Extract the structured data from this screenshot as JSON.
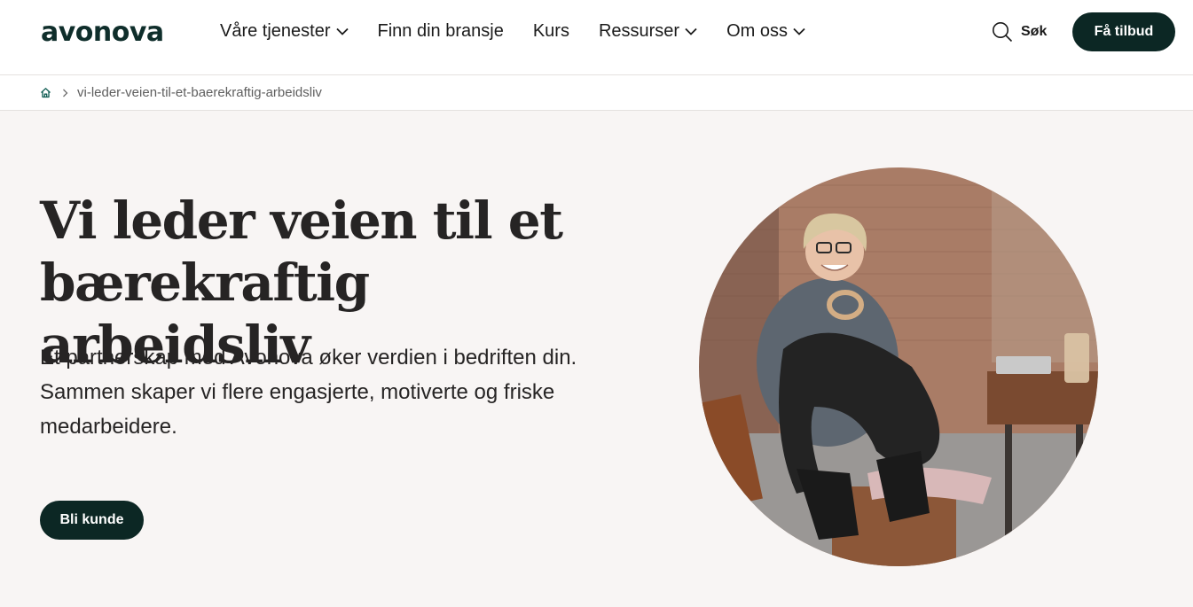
{
  "brand": {
    "logo_text": "avonova",
    "accent": "#0c2724"
  },
  "nav": {
    "items": [
      {
        "label": "Våre tjenester",
        "has_dropdown": true
      },
      {
        "label": "Finn din bransje",
        "has_dropdown": false
      },
      {
        "label": "Kurs",
        "has_dropdown": false
      },
      {
        "label": "Ressurser",
        "has_dropdown": true
      },
      {
        "label": "Om oss",
        "has_dropdown": true
      }
    ],
    "search_label": "Søk",
    "cta_label": "Få tilbud"
  },
  "breadcrumb": {
    "home_icon": "home-icon",
    "current": "vi-leder-veien-til-et-baerekraftig-arbeidsliv"
  },
  "hero": {
    "title": "Vi leder veien til et bærekraftig arbeidsliv",
    "subtitle": "Et partnerskap med Avonova øker verdien i bedriften din. Sammen skaper vi flere engasjerte, motiverte og friske medarbeidere.",
    "button_label": "Bli kunde",
    "image_alt": "Smiling woman with glasses sitting on a café chair in front of a brick wall"
  }
}
